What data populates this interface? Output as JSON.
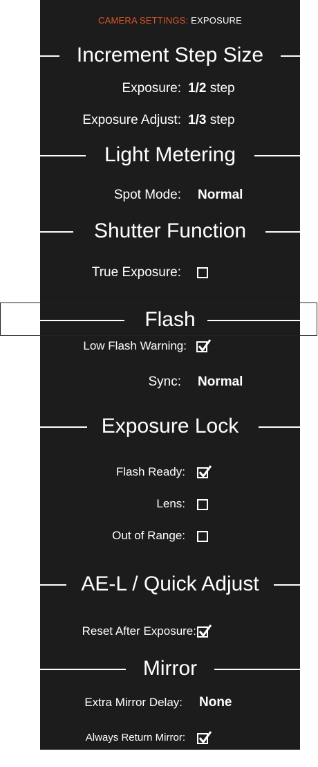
{
  "breadcrumb": {
    "category": "CAMERA SETTINGS:",
    "page": "EXPOSURE"
  },
  "sections": {
    "increment": {
      "title": "Increment Step Size"
    },
    "metering": {
      "title": "Light Metering"
    },
    "shutter": {
      "title": "Shutter Function"
    },
    "flash": {
      "title": "Flash"
    },
    "lock": {
      "title": "Exposure Lock"
    },
    "ael": {
      "title": "AE-L / Quick Adjust"
    },
    "mirror": {
      "title": "Mirror"
    }
  },
  "settings": {
    "exposure": {
      "label": "Exposure:",
      "value": "1/2",
      "unit": "step"
    },
    "exposure_adjust": {
      "label": "Exposure Adjust:",
      "value": "1/3",
      "unit": "step"
    },
    "spot_mode": {
      "label": "Spot Mode:",
      "value": "Normal"
    },
    "true_exposure": {
      "label": "True Exposure:",
      "checked": false
    },
    "low_flash_warning": {
      "label": "Low Flash Warning:",
      "checked": true
    },
    "sync": {
      "label": "Sync:",
      "value": "Normal"
    },
    "flash_ready": {
      "label": "Flash Ready:",
      "checked": true
    },
    "lens": {
      "label": "Lens:",
      "checked": false
    },
    "out_of_range": {
      "label": "Out of Range:",
      "checked": false
    },
    "reset_after_exposure": {
      "label": "Reset After Exposure:",
      "checked": true
    },
    "extra_mirror_delay": {
      "label": "Extra Mirror Delay:",
      "value": "None"
    },
    "always_return_mirror": {
      "label": "Always Return Mirror:",
      "checked": true
    }
  },
  "colors": {
    "background": "#1c1c1c",
    "accent": "#e2552b",
    "text": "#ffffff"
  }
}
